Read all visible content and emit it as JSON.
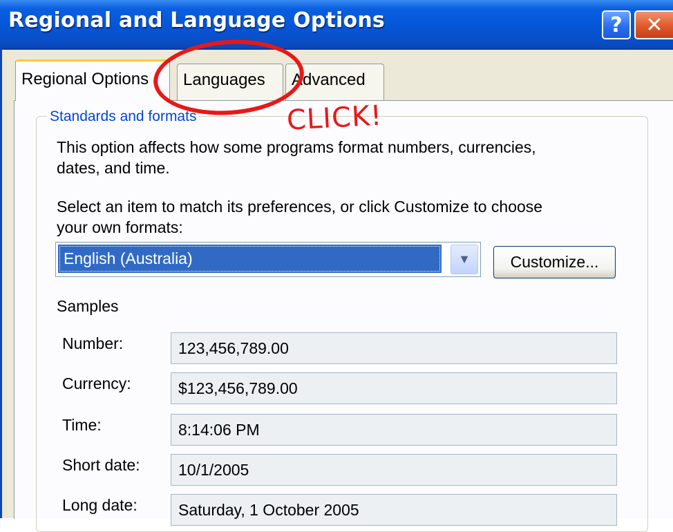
{
  "window": {
    "title": "Regional and Language Options",
    "help_label": "?",
    "close_label": "✕"
  },
  "tabs": [
    {
      "label": "Regional Options",
      "active": true
    },
    {
      "label": "Languages",
      "active": false
    },
    {
      "label": "Advanced",
      "active": false
    }
  ],
  "standards": {
    "group_title": "Standards and formats",
    "description_line1": "This option affects how some programs format numbers, currencies,",
    "description_line2": "dates, and time.",
    "instruction_line1": "Select an item to match its preferences, or click Customize to choose",
    "instruction_line2": "your own formats:",
    "locale_value": "English (Australia)",
    "customize_label": "Customize..."
  },
  "samples": {
    "heading": "Samples",
    "rows": [
      {
        "label": "Number:",
        "value": "123,456,789.00"
      },
      {
        "label": "Currency:",
        "value": "$123,456,789.00"
      },
      {
        "label": "Time:",
        "value": "8:14:06 PM"
      },
      {
        "label": "Short date:",
        "value": "10/1/2005"
      },
      {
        "label": "Long date:",
        "value": "Saturday, 1 October 2005"
      }
    ]
  },
  "annotation": {
    "note": "CLICK!",
    "color": "#e81818"
  },
  "colors": {
    "titlebar": "#0457d8",
    "dialog_bg": "#ece9d8",
    "selection": "#316ac5",
    "group_title": "#0046d5"
  }
}
